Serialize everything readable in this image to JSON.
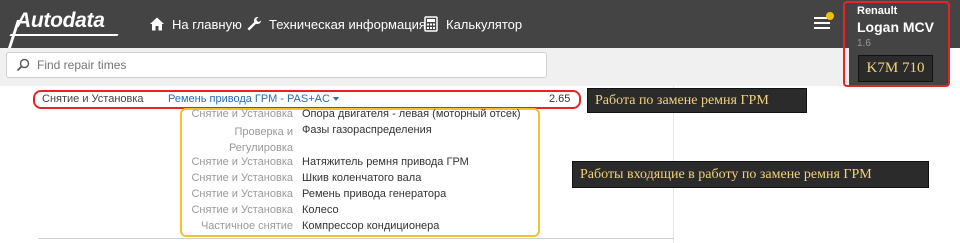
{
  "header": {
    "logo": "Autodata",
    "nav": [
      {
        "label": "На главную",
        "icon": "home-icon"
      },
      {
        "label": "Техническая информация",
        "icon": "wrench-icon"
      },
      {
        "label": "Калькулятор",
        "icon": "calculator-icon"
      }
    ],
    "menu_icon": "hamburger-menu-icon"
  },
  "vehicle": {
    "make": "Renault",
    "model": "Logan MCV",
    "engine": "1.6",
    "engine_code": "K7M 710"
  },
  "search": {
    "placeholder": "Find repair times"
  },
  "main_row": {
    "action": "Снятие и Установка",
    "link": "Ремень привода ГРМ - PAS+AC",
    "value": "2.65",
    "callout": "Работа по замене ремня ГРМ"
  },
  "sub_items": {
    "callout": "Работы входящие в работу по замене ремня ГРМ",
    "rows": [
      {
        "category": "Снятие и Установка",
        "name": "Опора двигателя - левая (моторный отсек)"
      },
      {
        "category": "Проверка и Регулировка",
        "name": "Фазы газораспределения"
      },
      {
        "category": "Снятие и Установка",
        "name": "Натяжитель ремня привода ГРМ"
      },
      {
        "category": "Снятие и Установка",
        "name": "Шкив коленчатого вала"
      },
      {
        "category": "Снятие и Установка",
        "name": "Ремень привода генератора"
      },
      {
        "category": "Снятие и Установка",
        "name": "Колесо"
      },
      {
        "category": "Частичное снятие",
        "name": "Компрессор кондиционера"
      }
    ]
  },
  "colors": {
    "header_bg": "#444444",
    "highlight_red": "#e5242a",
    "highlight_yellow": "#f2c230",
    "callout_text": "#f2d27a",
    "link_blue": "#2a6db5"
  }
}
